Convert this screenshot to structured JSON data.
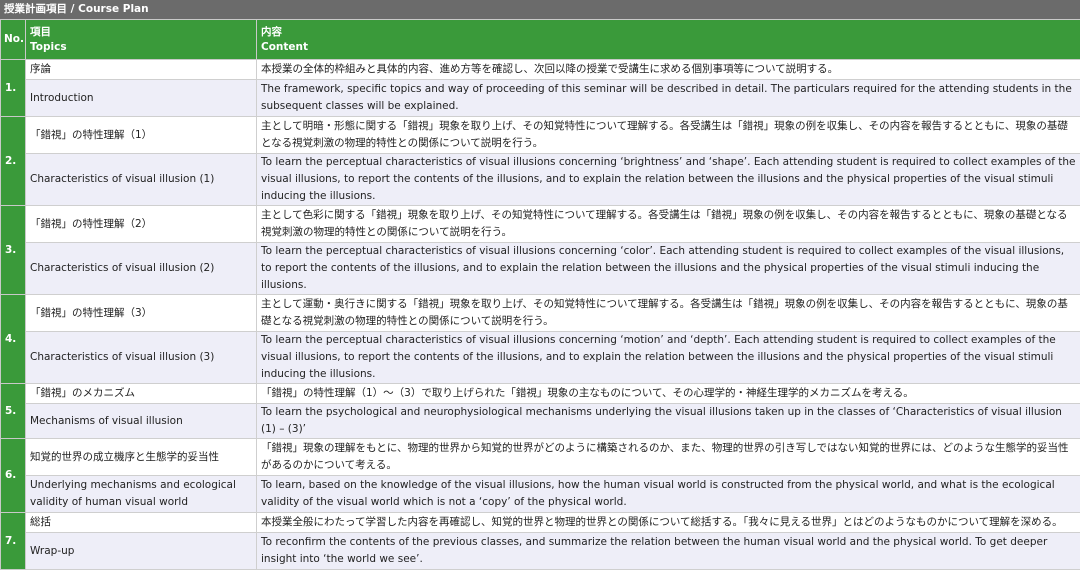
{
  "title": "授業計画項目 / Course Plan",
  "headers": {
    "no": "No.",
    "topics_ja": "項目",
    "topics_en": "Topics",
    "content_ja": "内容",
    "content_en": "Content"
  },
  "rows": [
    {
      "no": "1.",
      "topic_ja": "序論",
      "content_ja": "本授業の全体的枠組みと具体的内容、進め方等を確認し、次回以降の授業で受講生に求める個別事項等について説明する。",
      "topic_en": "Introduction",
      "content_en": "The framework, specific topics and way of proceeding of this seminar will be described in detail. The particulars required for the attending students in the subsequent classes will be explained."
    },
    {
      "no": "2.",
      "topic_ja": "「錯視」の特性理解（1）",
      "content_ja": "主として明暗・形態に関する「錯視」現象を取り上げ、その知覚特性について理解する。各受講生は「錯視」現象の例を収集し、その内容を報告するとともに、現象の基礎となる視覚刺激の物理的特性との関係について説明を行う。",
      "topic_en": "Characteristics of visual illusion (1)",
      "content_en": "To learn the perceptual characteristics of visual illusions concerning ‘brightness’ and ‘shape’. Each attending student is required to collect examples of the visual illusions, to report the contents of the illusions, and to explain the relation between the illusions and the physical properties of the visual stimuli inducing the illusions."
    },
    {
      "no": "3.",
      "topic_ja": "「錯視」の特性理解（2）",
      "content_ja": "主として色彩に関する「錯視」現象を取り上げ、その知覚特性について理解する。各受講生は「錯視」現象の例を収集し、その内容を報告するとともに、現象の基礎となる視覚刺激の物理的特性との関係について説明を行う。",
      "topic_en": "Characteristics of visual illusion (2)",
      "content_en": "To learn the perceptual characteristics of visual illusions concerning ‘color’. Each attending student is required to collect examples of the visual illusions, to report the contents of the illusions, and to explain the relation between the illusions and the physical properties of the visual stimuli inducing the illusions."
    },
    {
      "no": "4.",
      "topic_ja": "「錯視」の特性理解（3）",
      "content_ja": "主として運動・奥行きに関する「錯視」現象を取り上げ、その知覚特性について理解する。各受講生は「錯視」現象の例を収集し、その内容を報告するとともに、現象の基礎となる視覚刺激の物理的特性との関係について説明を行う。",
      "topic_en": "Characteristics of visual illusion (3)",
      "content_en": "To learn the perceptual characteristics of visual illusions concerning ‘motion’ and ‘depth’. Each attending student is required to collect examples of the visual illusions, to report the contents of the illusions, and to explain the relation between the illusions and the physical properties of the visual stimuli inducing the illusions."
    },
    {
      "no": "5.",
      "topic_ja": "「錯視」のメカニズム",
      "content_ja": "「錯視」の特性理解（1）～（3）で取り上げられた「錯視」現象の主なものについて、その心理学的・神経生理学的メカニズムを考える。",
      "topic_en": "Mechanisms of visual illusion",
      "content_en": "To learn the psychological and neurophysiological mechanisms underlying the visual illusions taken up in the classes of ‘Characteristics of visual illusion (1) – (3)’"
    },
    {
      "no": "6.",
      "topic_ja": "知覚的世界の成立機序と生態学的妥当性",
      "content_ja": "「錯視」現象の理解をもとに、物理的世界から知覚的世界がどのように構築されるのか、また、物理的世界の引き写しではない知覚的世界には、どのような生態学的妥当性があるのかについて考える。",
      "topic_en": "Underlying mechanisms and ecological validity of human visual world",
      "content_en": "To learn, based on the knowledge of the visual illusions, how the human visual world is constructed from the physical world, and what is the ecological validity of the visual world which is not a ‘copy’ of the physical world."
    },
    {
      "no": "7.",
      "topic_ja": "総括",
      "content_ja": "本授業全般にわたって学習した内容を再確認し、知覚的世界と物理的世界との関係について総括する。「我々に見える世界」とはどのようなものかについて理解を深める。",
      "topic_en": "Wrap-up",
      "content_en": "To reconfirm the contents of the previous classes, and summarize the relation between the human visual world and the physical world. To get deeper insight into ‘the world we see’."
    }
  ]
}
